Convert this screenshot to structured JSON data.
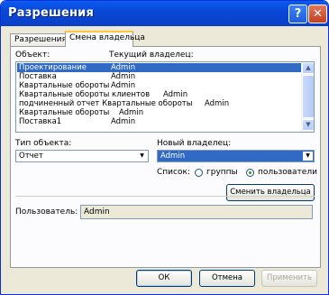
{
  "window": {
    "title": "Разрешения"
  },
  "titlebar": {
    "help_glyph": "?",
    "close_glyph": "✕"
  },
  "tabs": [
    {
      "label": "Разрешения"
    },
    {
      "label": "Смена владельца"
    }
  ],
  "object_list": {
    "col_object": "Объект:",
    "col_owner": "Текущий владелец:",
    "rows": [
      {
        "object": "Проектирование",
        "owner": "Admin",
        "selected": true
      },
      {
        "object": "Поставка",
        "owner": "Admin"
      },
      {
        "object": "Квартальные обороты",
        "owner": "Admin"
      },
      {
        "object": "Квартальные обороты клиентов",
        "owner": "Admin"
      },
      {
        "object": "подчиненный отчет Квартальные обороты",
        "owner": "Admin"
      },
      {
        "object": "Квартальные обороты",
        "owner": "Admin"
      },
      {
        "object": "Поставка1",
        "owner": "Admin"
      }
    ]
  },
  "object_type": {
    "label": "Тип объекта:",
    "value": "Отчет"
  },
  "new_owner": {
    "label": "Новый владелец:",
    "value": "Admin"
  },
  "list_filter": {
    "label": "Список:",
    "options": [
      {
        "label": "группы",
        "checked": false
      },
      {
        "label": "пользователи",
        "checked": true
      }
    ]
  },
  "change_owner_button": "Сменить владельца",
  "current_user": {
    "label": "Пользователь:",
    "value": "Admin"
  },
  "footer": {
    "ok": "ОК",
    "cancel": "Отмена",
    "apply": "Применить"
  }
}
